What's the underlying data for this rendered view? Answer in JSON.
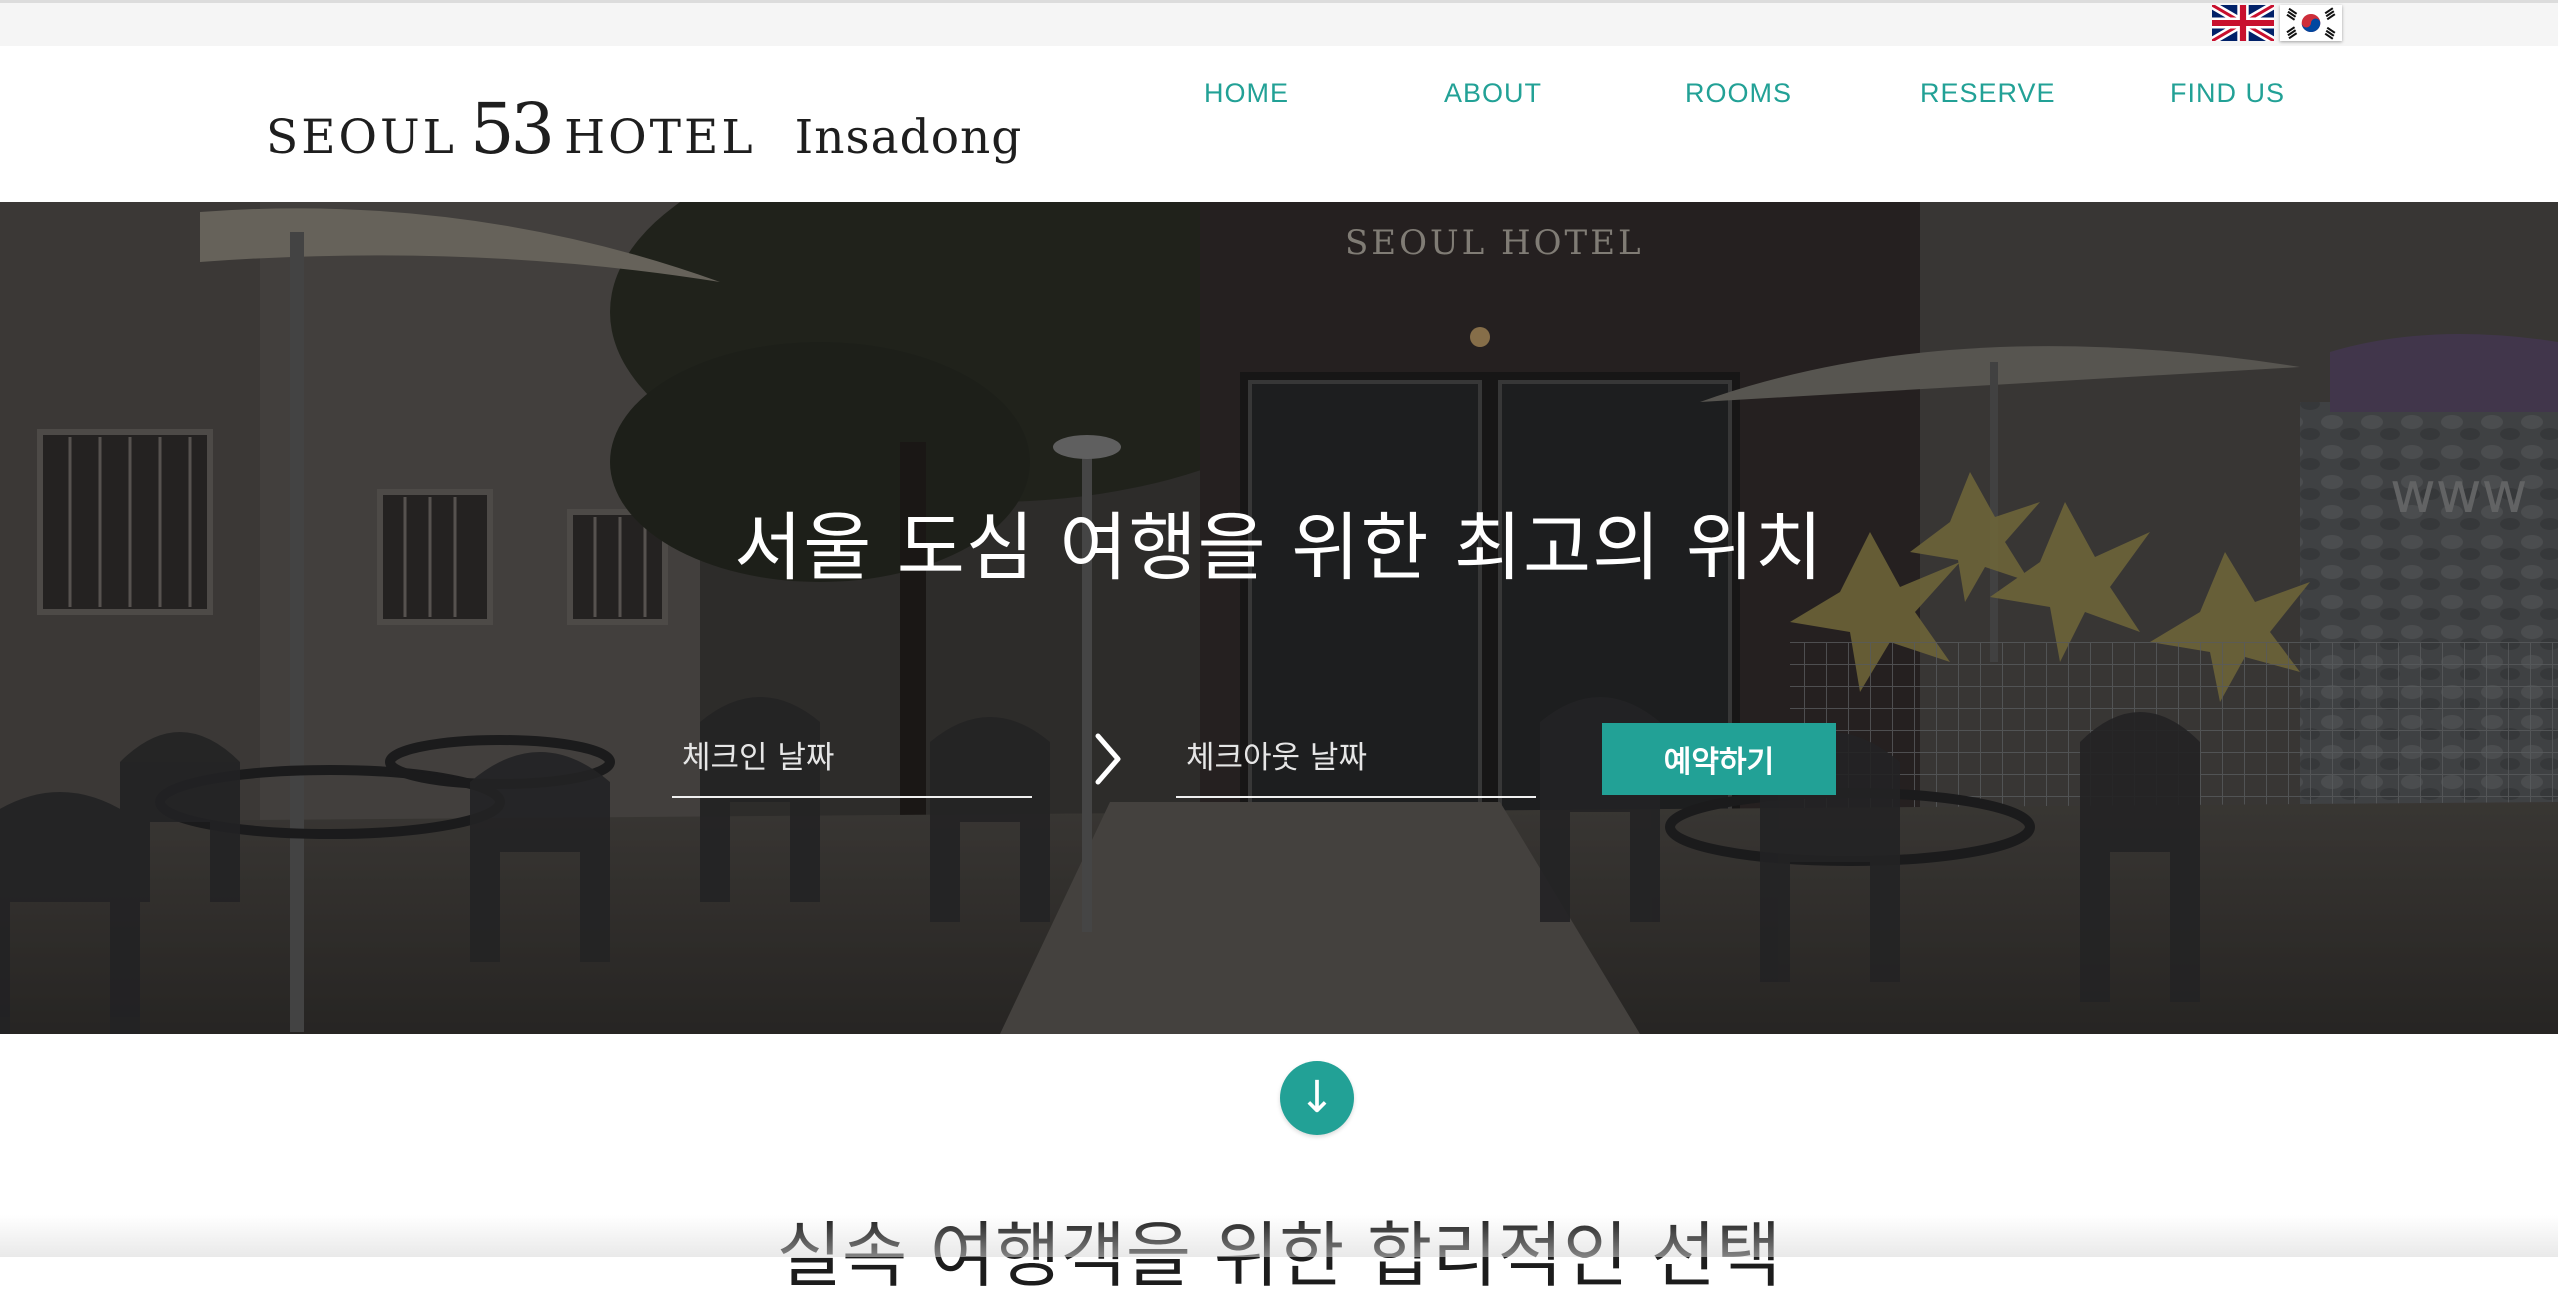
{
  "language": {
    "english_flag_icon": "uk-flag-icon",
    "korean_flag_icon": "korea-flag-icon"
  },
  "header": {
    "logo": {
      "seoul": "SEOUL",
      "number": "53",
      "hotel": "HOTEL",
      "area": "Insadong"
    },
    "nav": [
      "HOME",
      "ABOUT",
      "ROOMS",
      "RESERVE",
      "FIND US"
    ],
    "accent_color": "#22a196"
  },
  "hero": {
    "title": "서울 도심 여행을 위한 최고의 위치",
    "checkin_placeholder": "체크인 날짜",
    "checkout_placeholder": "체크아웃 날짜",
    "arrow_icon": "chevron-right-icon",
    "reserve_label": "예약하기",
    "background_sign": "SEOUL  HOTEL",
    "background_sign_www": "www"
  },
  "intro": {
    "scroll_icon": "arrow-down-icon",
    "scroll_glyph": "↓",
    "title": "실속 여행객을 위한 합리적인 선택"
  }
}
